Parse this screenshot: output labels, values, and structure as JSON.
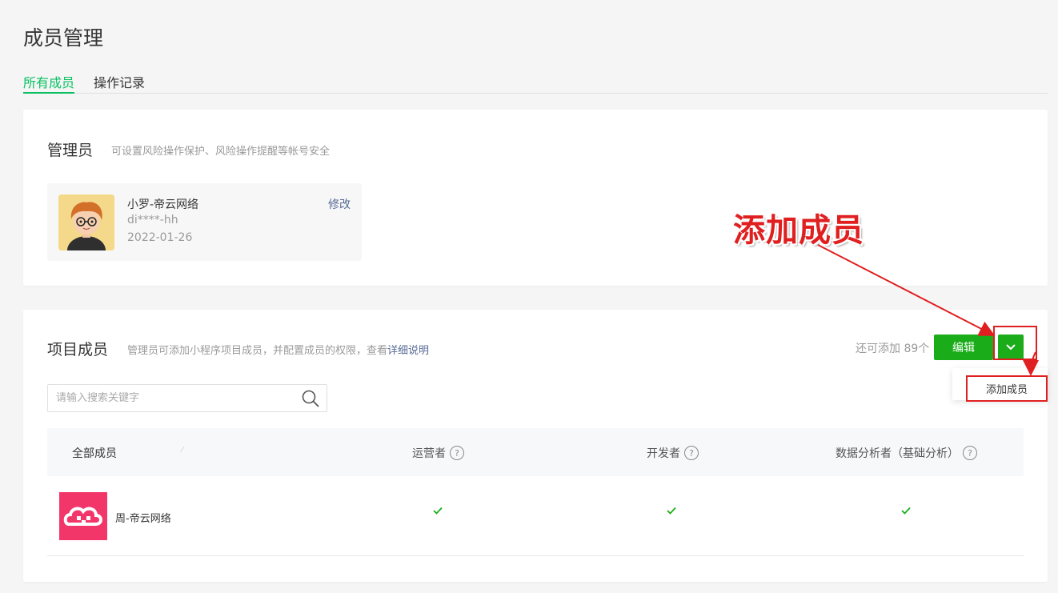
{
  "page": {
    "title": "成员管理",
    "tabs": [
      {
        "label": "所有成员",
        "active": true
      },
      {
        "label": "操作记录",
        "active": false
      }
    ]
  },
  "admin_section": {
    "title": "管理员",
    "description": "可设置风险操作保护、风险操作提醒等帐号安全",
    "admin": {
      "name": "小罗-帝云网络",
      "id": "di****-hh",
      "date": "2022-01-26",
      "edit_label": "修改"
    }
  },
  "members_section": {
    "title": "项目成员",
    "description_prefix": "管理员可添加小程序项目成员，并配置成员的权限，查看",
    "description_link": "详细说明",
    "remaining": "还可添加 89个",
    "edit_button": "编辑",
    "dropdown_item": "添加成员",
    "search_placeholder": "请输入搜索关键字",
    "columns": [
      {
        "label": "全部成员"
      },
      {
        "label": "运营者",
        "help": "?"
      },
      {
        "label": "开发者",
        "help": "?"
      },
      {
        "label": "数据分析者（基础分析）",
        "help": "?"
      }
    ],
    "rows": [
      {
        "name": "周-帝云网络",
        "operator": true,
        "developer": true,
        "analyst": true
      }
    ]
  },
  "annotation": {
    "text": "添加成员",
    "color": "#e02020"
  },
  "colors": {
    "accent_green": "#07c160",
    "button_green": "#1aad19",
    "link_blue": "#576b95",
    "highlight_red": "#e02020"
  },
  "icons": {
    "search": "search-icon",
    "dropdown": "chevron-down-icon",
    "check": "check-icon",
    "help": "question-circle-icon"
  }
}
